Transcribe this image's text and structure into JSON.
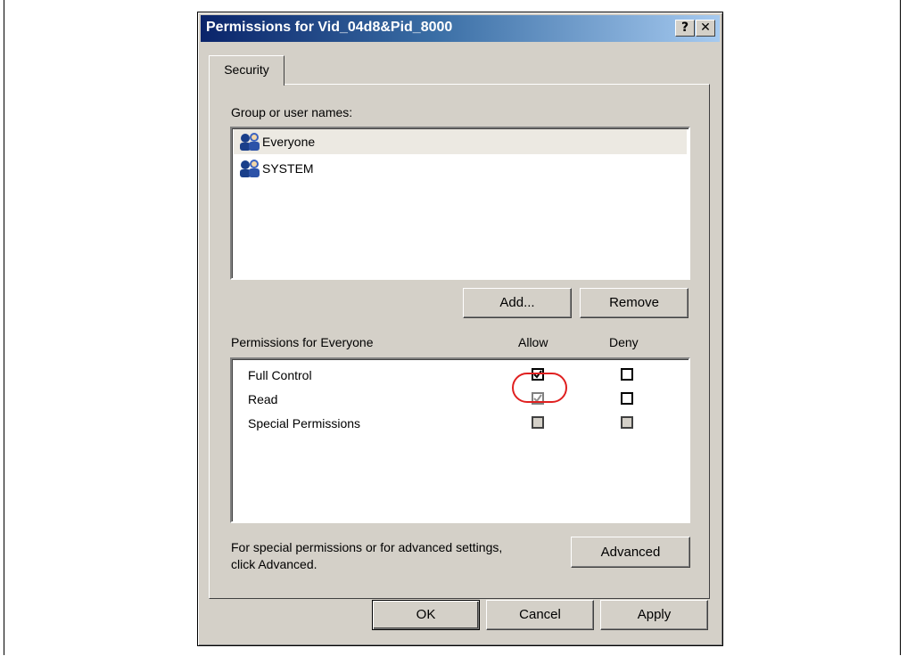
{
  "dialog": {
    "title": "Permissions for Vid_04d8&Pid_8000",
    "help_button": "?",
    "close_button": "✕",
    "tab_label": "Security"
  },
  "users": {
    "label": "Group or user names:",
    "items": [
      {
        "name": "Everyone",
        "icon": "user-group-icon",
        "selected": true
      },
      {
        "name": "SYSTEM",
        "icon": "user-group-icon",
        "selected": false
      }
    ],
    "add_label": "Add...",
    "remove_label": "Remove"
  },
  "permissions": {
    "label": "Permissions for Everyone",
    "allow_header": "Allow",
    "deny_header": "Deny",
    "rows": [
      {
        "name": "Full Control",
        "allow": "checked",
        "deny": "unchecked"
      },
      {
        "name": "Read",
        "allow": "checked-disabled",
        "deny": "unchecked"
      },
      {
        "name": "Special Permissions",
        "allow": "unchecked-disabled",
        "deny": "unchecked-disabled"
      }
    ]
  },
  "advanced": {
    "text_line1": "For special permissions or for advanced settings,",
    "text_line2": "click Advanced.",
    "button_label": "Advanced"
  },
  "footer": {
    "ok_label": "OK",
    "cancel_label": "Cancel",
    "apply_label": "Apply"
  },
  "colors": {
    "titlebar_start": "#0a246a",
    "titlebar_end": "#a6caf0",
    "face": "#d4d0c8",
    "highlight_ring": "#e02020"
  }
}
